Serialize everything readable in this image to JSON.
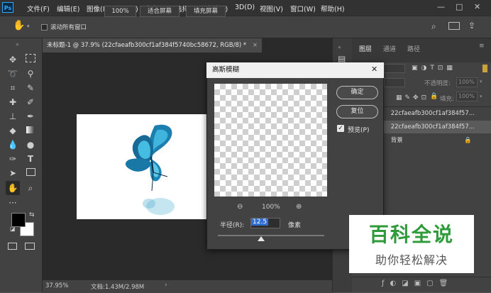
{
  "app": {
    "logo": "Ps"
  },
  "menu": [
    "文件(F)",
    "编辑(E)",
    "图像(I)",
    "图层(L)",
    "文字(Y)",
    "选择(S)",
    "滤镜(T)",
    "3D(D)",
    "视图(V)",
    "窗口(W)",
    "帮助(H)"
  ],
  "window_controls": {
    "minimize": "—",
    "maximize": "□",
    "close": "✕"
  },
  "options_bar": {
    "scroll_all_label": "滚动所有窗口",
    "zoom_label": "100%",
    "fit_screen": "适合屏幕",
    "fill_screen": "填充屏幕"
  },
  "document": {
    "tab_title": "未标题-1 @ 37.9% (22cfaeafb300cf1af384f5740bc58672, RGB/8) *",
    "tab_close": "×",
    "status_zoom": "37.95%",
    "status_doc": "文档:1.43M/2.98M"
  },
  "panels": {
    "tabs": [
      "图层",
      "通道",
      "路径"
    ],
    "opacity_label": "不透明度:",
    "fill_label": "填充:",
    "opacity_value": "100%",
    "fill_value": "100%",
    "layers": [
      {
        "name": "22cfaeafb300cf1af384f57..."
      },
      {
        "name": "22cfaeafb300cf1af384f57..."
      },
      {
        "name": "背景"
      }
    ]
  },
  "dialog": {
    "title": "高斯模糊",
    "close": "✕",
    "ok": "确定",
    "reset": "复位",
    "preview_label": "预览(P)",
    "preview_checked": true,
    "zoom_percent": "100%",
    "radius_label": "半径(R):",
    "radius_value": "12.5",
    "radius_unit": "像素"
  },
  "watermark": {
    "title": "百科全说",
    "subtitle": "助你轻松解决"
  },
  "colors": {
    "accent": "#31a8ff",
    "watermark_green": "#2e9a3a",
    "butterfly": "#1f8fb8"
  }
}
